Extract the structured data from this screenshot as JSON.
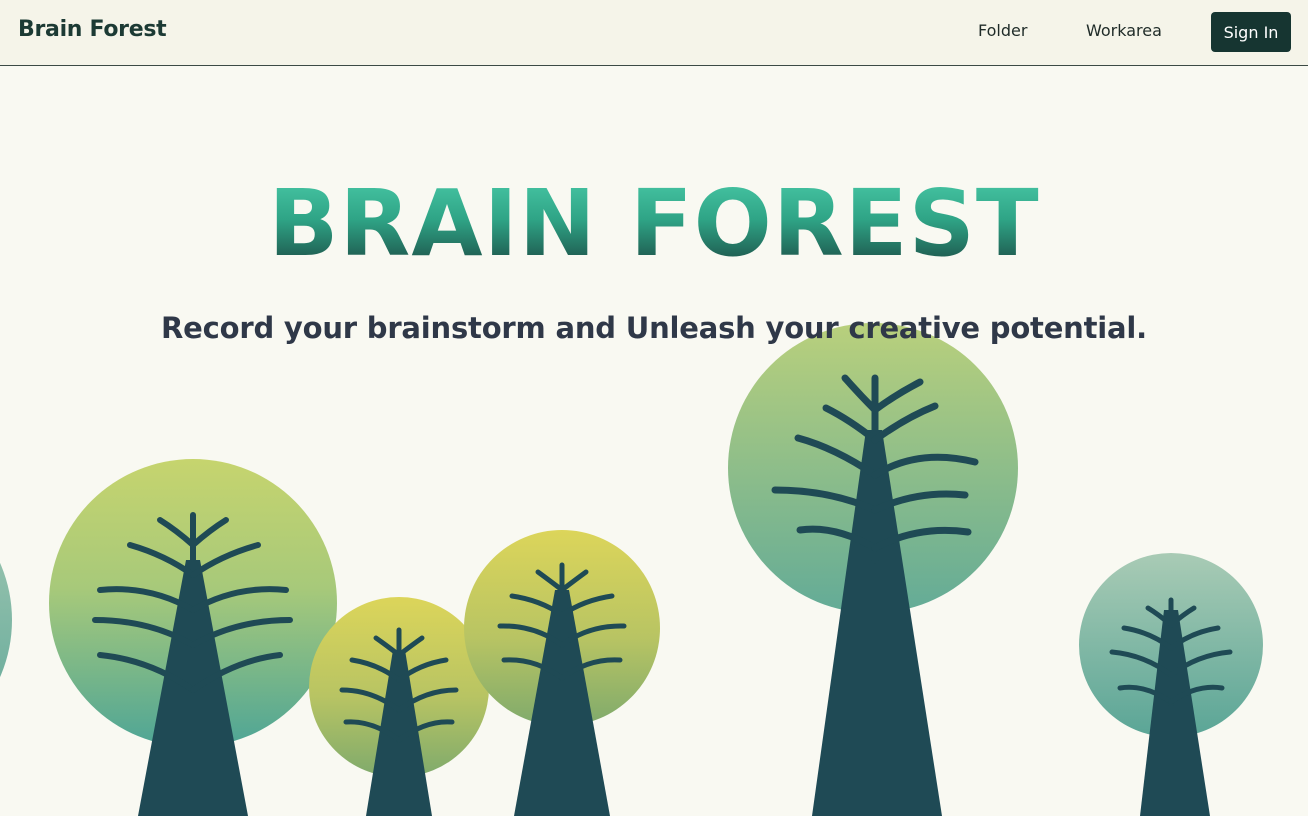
{
  "header": {
    "brand": "Brain Forest",
    "nav": {
      "folder": "Folder",
      "workarea": "Workarea"
    },
    "signin_label": "Sign In"
  },
  "hero": {
    "title": "BRAIN FOREST",
    "subtitle": "Record your brainstorm and Unleash your creative potential."
  },
  "colors": {
    "accent": "#163531",
    "trunk": "#1f4a55",
    "canopy_top": "#c3d36f",
    "canopy_bottom": "#4ea596"
  },
  "illustration": {
    "icon": "tree-illustration"
  }
}
